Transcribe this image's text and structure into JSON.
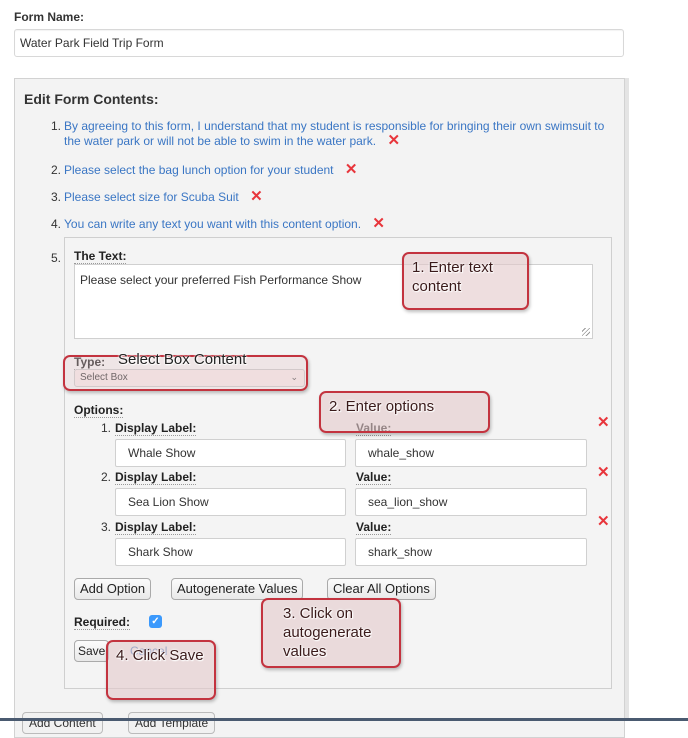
{
  "form_name": {
    "label": "Form Name:",
    "value": "Water Park Field Trip Form"
  },
  "edit_panel": {
    "title": "Edit Form Contents:",
    "items": [
      {
        "num": "1.",
        "text": "By agreeing to this form, I understand that my student is responsible for bringing their own swimsuit to the water park or will not be able to swim in the water park."
      },
      {
        "num": "2.",
        "text": "Please select the bag lunch option for your student"
      },
      {
        "num": "3.",
        "text": "Please select size for Scuba Suit"
      },
      {
        "num": "4.",
        "text": "You can write any text you want with this content option."
      }
    ],
    "delete_icon": "✕",
    "editing_item": {
      "num": "5.",
      "text_label": "The Text:",
      "text_value": "Please select your preferred Fish Performance Show",
      "type_label": "Type:",
      "type_value": "Select Box",
      "options_label": "Options:",
      "display_label": "Display Label:",
      "value_label": "Value:",
      "options": [
        {
          "num": "1.",
          "display": "Whale Show",
          "value": "whale_show"
        },
        {
          "num": "2.",
          "display": "Sea Lion Show",
          "value": "sea_lion_show"
        },
        {
          "num": "3.",
          "display": "Shark Show",
          "value": "shark_show"
        }
      ],
      "add_option": "Add Option",
      "autogenerate": "Autogenerate Values",
      "clear_all": "Clear All Options",
      "required_label": "Required:",
      "required_checked": true,
      "save": "Save",
      "cancel": "Cancel"
    }
  },
  "callouts": {
    "step1": "1. Enter text content",
    "type_note": "Select Box Content",
    "step2": "2. Enter options",
    "step3": "3. Click on autogenerate values",
    "step4": "4. Click Save"
  },
  "bottom_buttons": {
    "add_content": "Add Content",
    "add_template": "Add Template"
  },
  "colors": {
    "link_blue": "#3a76c4",
    "delete_red": "#e8353b",
    "callout_border": "#c3333f",
    "checkbox_blue": "#3b99fc"
  }
}
